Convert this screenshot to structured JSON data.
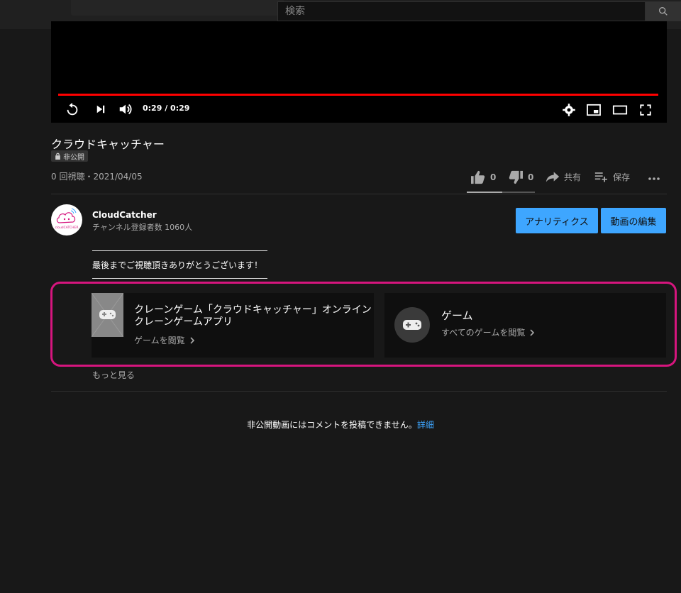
{
  "search": {
    "placeholder": "検索"
  },
  "player": {
    "time": "0:29 / 0:29"
  },
  "video": {
    "title": "クラウドキャッチャー",
    "privacy": "非公開",
    "views": "0 回視聴・2021/04/05"
  },
  "actions": {
    "likes": "0",
    "dislikes": "0",
    "share": "共有",
    "save": "保存"
  },
  "channel": {
    "name": "CloudCatcher",
    "subscribers": "チャンネル登録者数 1060人",
    "avatar_text": "cloudCATCHER"
  },
  "buttons": {
    "analytics": "アナリティクス",
    "edit": "動画の編集"
  },
  "description": "最後までご視聴頂きありがとうございます！",
  "cards": [
    {
      "title": "クレーンゲーム「クラウドキャッチャー」オンラインクレーンゲームアプリ",
      "link": "ゲームを閲覧"
    },
    {
      "title": "ゲーム",
      "link": "すべてのゲームを閲覧"
    }
  ],
  "more": "もっと見る",
  "comments": {
    "note": "非公開動画にはコメントを投稿できません。",
    "link": "詳細"
  },
  "colors": {
    "accent_blue": "#3ea6ff",
    "progress_red": "#ff0000",
    "highlight_pink": "#d6157e"
  }
}
